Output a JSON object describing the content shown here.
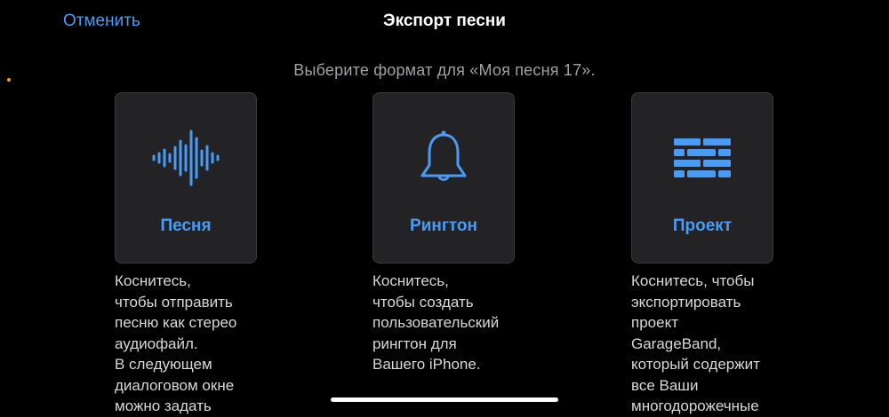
{
  "header": {
    "cancel_label": "Отменить",
    "title": "Экспорт песни"
  },
  "subtitle": "Выберите формат для «Моя песня 17».",
  "options": [
    {
      "label": "Песня",
      "icon": "waveform-icon",
      "description": "Коснитесь,\nчтобы отправить\nпесню как стерео\nаудиофайл.\nВ следующем\nдиалоговом окне\nможно задать"
    },
    {
      "label": "Рингтон",
      "icon": "bell-icon",
      "description": "Коснитесь,\nчтобы создать\nпользовательский\nрингтон для\nВашего iPhone."
    },
    {
      "label": "Проект",
      "icon": "bricks-icon",
      "description": "Коснитесь, чтобы\nэкспортировать\nпроект\nGarageBand,\nкоторый содержит\nвсе Ваши\nмногодорожечные"
    }
  ],
  "colors": {
    "accent": "#4a9bf5",
    "background": "#000000",
    "card": "#232325",
    "status_dot": "#f0a020"
  }
}
